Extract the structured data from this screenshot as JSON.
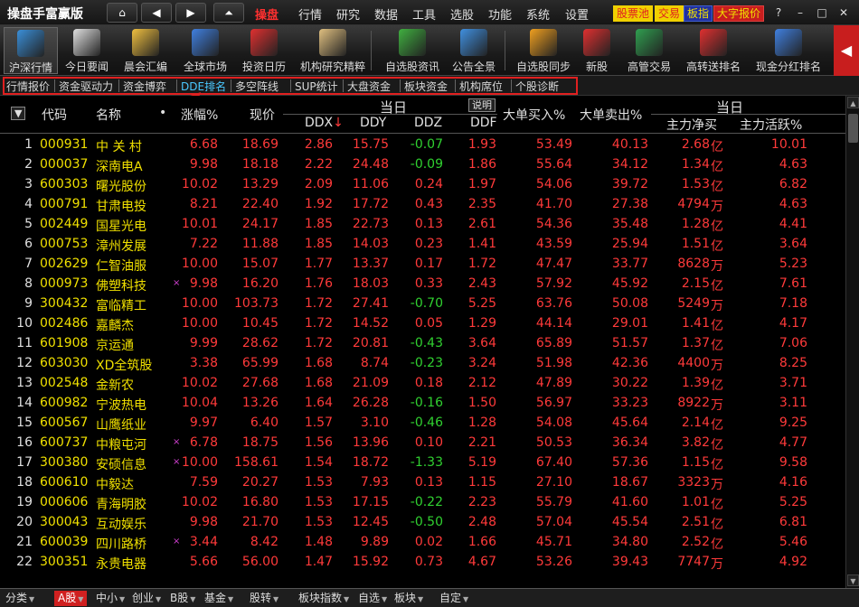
{
  "app": {
    "title": "操盘手富赢版"
  },
  "nav": {
    "home": "⌂",
    "back": "◀",
    "forward": "▶",
    "top": "⏶"
  },
  "menu": [
    "操盘",
    "行情",
    "研究",
    "数据",
    "工具",
    "选股",
    "功能",
    "系统",
    "设置"
  ],
  "menu_active": 0,
  "tag_buttons": [
    "股票池",
    "交易",
    "板指",
    "大字报价"
  ],
  "window_controls": [
    "?",
    "–",
    "□",
    "✕"
  ],
  "toolbar": [
    {
      "label": "沪深行情",
      "icon": "market-chart-icon",
      "color": "#3a8fd8"
    },
    {
      "label": "今日要闻",
      "icon": "newspaper-icon",
      "color": "#e0e0e0"
    },
    {
      "label": "晨会汇编",
      "icon": "person-icon",
      "color": "#f0c040"
    },
    {
      "label": "全球市场",
      "icon": "globe-icon",
      "color": "#4080e0"
    },
    {
      "label": "投资日历",
      "icon": "calendar-icon",
      "color": "#e03030"
    },
    {
      "label": "机构研究精粹",
      "icon": "clipboard-icon",
      "color": "#e0c080"
    },
    {
      "label": "自选股资讯",
      "icon": "money-hand-icon",
      "color": "#40b040"
    },
    {
      "label": "公告全景",
      "icon": "megaphone-icon",
      "color": "#4090e0"
    },
    {
      "label": "自选股同步",
      "icon": "sync-icon",
      "color": "#f0a020"
    },
    {
      "label": "新股",
      "icon": "new-stock-icon",
      "color": "#e03030"
    },
    {
      "label": "高管交易",
      "icon": "monitor-new-icon",
      "color": "#30a050"
    },
    {
      "label": "高转送排名",
      "icon": "calendar-rank-icon",
      "color": "#e03030"
    },
    {
      "label": "现金分红排名",
      "icon": "bar-chart-icon",
      "color": "#4080e0"
    }
  ],
  "subtabs": [
    "行情报价",
    "资金驱动力",
    "资金博弈",
    "DDE排名",
    "多空阵线",
    "SUP统计",
    "大盘资金",
    "板块资金",
    "机构席位",
    "个股诊断"
  ],
  "subtab_active": 3,
  "header": {
    "menu_glyph": "▼",
    "code": "代码",
    "name": "名称",
    "dot": "•",
    "change": "涨幅%",
    "price": "现价",
    "group1": "当日",
    "ddx": "DDX",
    "ddx_sort": "↓",
    "ddy": "DDY",
    "ddz": "DDZ",
    "ddf": "DDF",
    "explain": "说明",
    "big_buy": "大单买入%",
    "big_sell": "大单卖出%",
    "group2": "当日",
    "net_main": "主力净买",
    "main_active": "主力活跃%"
  },
  "rows": [
    {
      "idx": "1",
      "code": "000931",
      "name": "中 关 村",
      "mark": "",
      "chg": "6.68",
      "price": "18.69",
      "ddx": "2.86",
      "ddy": "15.75",
      "ddz": "-0.07",
      "ddf": "1.93",
      "buy": "53.49",
      "sell": "40.13",
      "net": "2.68",
      "unit": "亿",
      "act": "10.01"
    },
    {
      "idx": "2",
      "code": "000037",
      "name": "深南电A",
      "mark": "",
      "chg": "9.98",
      "price": "18.18",
      "ddx": "2.22",
      "ddy": "24.48",
      "ddz": "-0.09",
      "ddf": "1.86",
      "buy": "55.64",
      "sell": "34.12",
      "net": "1.34",
      "unit": "亿",
      "act": "4.63"
    },
    {
      "idx": "3",
      "code": "600303",
      "name": "曙光股份",
      "mark": "",
      "chg": "10.02",
      "price": "13.29",
      "ddx": "2.09",
      "ddy": "11.06",
      "ddz": "0.24",
      "ddf": "1.97",
      "buy": "54.06",
      "sell": "39.72",
      "net": "1.53",
      "unit": "亿",
      "act": "6.82"
    },
    {
      "idx": "4",
      "code": "000791",
      "name": "甘肃电投",
      "mark": "",
      "chg": "8.21",
      "price": "22.40",
      "ddx": "1.92",
      "ddy": "17.72",
      "ddz": "0.43",
      "ddf": "2.35",
      "buy": "41.70",
      "sell": "27.38",
      "net": "4794",
      "unit": "万",
      "act": "4.63"
    },
    {
      "idx": "5",
      "code": "002449",
      "name": "国星光电",
      "mark": "",
      "chg": "10.01",
      "price": "24.17",
      "ddx": "1.85",
      "ddy": "22.73",
      "ddz": "0.13",
      "ddf": "2.61",
      "buy": "54.36",
      "sell": "35.48",
      "net": "1.28",
      "unit": "亿",
      "act": "4.41"
    },
    {
      "idx": "6",
      "code": "000753",
      "name": "漳州发展",
      "mark": "",
      "chg": "7.22",
      "price": "11.88",
      "ddx": "1.85",
      "ddy": "14.03",
      "ddz": "0.23",
      "ddf": "1.41",
      "buy": "43.59",
      "sell": "25.94",
      "net": "1.51",
      "unit": "亿",
      "act": "3.64"
    },
    {
      "idx": "7",
      "code": "002629",
      "name": "仁智油服",
      "mark": "",
      "chg": "10.00",
      "price": "15.07",
      "ddx": "1.77",
      "ddy": "13.37",
      "ddz": "0.17",
      "ddf": "1.72",
      "buy": "47.47",
      "sell": "33.77",
      "net": "8628",
      "unit": "万",
      "act": "5.23"
    },
    {
      "idx": "8",
      "code": "000973",
      "name": "佛塑科技",
      "mark": "×",
      "chg": "9.98",
      "price": "16.20",
      "ddx": "1.76",
      "ddy": "18.03",
      "ddz": "0.33",
      "ddf": "2.43",
      "buy": "57.92",
      "sell": "45.92",
      "net": "2.15",
      "unit": "亿",
      "act": "7.61"
    },
    {
      "idx": "9",
      "code": "300432",
      "name": "富临精工",
      "mark": "",
      "chg": "10.00",
      "price": "103.73",
      "ddx": "1.72",
      "ddy": "27.41",
      "ddz": "-0.70",
      "ddf": "5.25",
      "buy": "63.76",
      "sell": "50.08",
      "net": "5249",
      "unit": "万",
      "act": "7.18"
    },
    {
      "idx": "10",
      "code": "002486",
      "name": "嘉麟杰",
      "mark": "",
      "chg": "10.00",
      "price": "10.45",
      "ddx": "1.72",
      "ddy": "14.52",
      "ddz": "0.05",
      "ddf": "1.29",
      "buy": "44.14",
      "sell": "29.01",
      "net": "1.41",
      "unit": "亿",
      "act": "4.17"
    },
    {
      "idx": "11",
      "code": "601908",
      "name": "京运通",
      "mark": "",
      "chg": "9.99",
      "price": "28.62",
      "ddx": "1.72",
      "ddy": "20.81",
      "ddz": "-0.43",
      "ddf": "3.64",
      "buy": "65.89",
      "sell": "51.57",
      "net": "1.37",
      "unit": "亿",
      "act": "7.06"
    },
    {
      "idx": "12",
      "code": "603030",
      "name": "XD全筑股",
      "mark": "",
      "chg": "3.38",
      "price": "65.99",
      "ddx": "1.68",
      "ddy": "8.74",
      "ddz": "-0.23",
      "ddf": "3.24",
      "buy": "51.98",
      "sell": "42.36",
      "net": "4400",
      "unit": "万",
      "act": "8.25"
    },
    {
      "idx": "13",
      "code": "002548",
      "name": "金新农",
      "mark": "",
      "chg": "10.02",
      "price": "27.68",
      "ddx": "1.68",
      "ddy": "21.09",
      "ddz": "0.18",
      "ddf": "2.12",
      "buy": "47.89",
      "sell": "30.22",
      "net": "1.39",
      "unit": "亿",
      "act": "3.71"
    },
    {
      "idx": "14",
      "code": "600982",
      "name": "宁波热电",
      "mark": "",
      "chg": "10.04",
      "price": "13.26",
      "ddx": "1.64",
      "ddy": "26.28",
      "ddz": "-0.16",
      "ddf": "1.50",
      "buy": "56.97",
      "sell": "33.23",
      "net": "8922",
      "unit": "万",
      "act": "3.11"
    },
    {
      "idx": "15",
      "code": "600567",
      "name": "山鹰纸业",
      "mark": "",
      "chg": "9.97",
      "price": "6.40",
      "ddx": "1.57",
      "ddy": "3.10",
      "ddz": "-0.46",
      "ddf": "1.28",
      "buy": "54.08",
      "sell": "45.64",
      "net": "2.14",
      "unit": "亿",
      "act": "9.25"
    },
    {
      "idx": "16",
      "code": "600737",
      "name": "中粮屯河",
      "mark": "×",
      "chg": "6.78",
      "price": "18.75",
      "ddx": "1.56",
      "ddy": "13.96",
      "ddz": "0.10",
      "ddf": "2.21",
      "buy": "50.53",
      "sell": "36.34",
      "net": "3.82",
      "unit": "亿",
      "act": "4.77"
    },
    {
      "idx": "17",
      "code": "300380",
      "name": "安硕信息",
      "mark": "×",
      "chg": "10.00",
      "price": "158.61",
      "ddx": "1.54",
      "ddy": "18.72",
      "ddz": "-1.33",
      "ddf": "5.19",
      "buy": "67.40",
      "sell": "57.36",
      "net": "1.15",
      "unit": "亿",
      "act": "9.58"
    },
    {
      "idx": "18",
      "code": "600610",
      "name": "中毅达",
      "mark": "",
      "chg": "7.59",
      "price": "20.27",
      "ddx": "1.53",
      "ddy": "7.93",
      "ddz": "0.13",
      "ddf": "1.15",
      "buy": "27.10",
      "sell": "18.67",
      "net": "3323",
      "unit": "万",
      "act": "4.16"
    },
    {
      "idx": "19",
      "code": "000606",
      "name": "青海明胶",
      "mark": "",
      "chg": "10.02",
      "price": "16.80",
      "ddx": "1.53",
      "ddy": "17.15",
      "ddz": "-0.22",
      "ddf": "2.23",
      "buy": "55.79",
      "sell": "41.60",
      "net": "1.01",
      "unit": "亿",
      "act": "5.25"
    },
    {
      "idx": "20",
      "code": "300043",
      "name": "互动娱乐",
      "mark": "",
      "chg": "9.98",
      "price": "21.70",
      "ddx": "1.53",
      "ddy": "12.45",
      "ddz": "-0.50",
      "ddf": "2.48",
      "buy": "57.04",
      "sell": "45.54",
      "net": "2.51",
      "unit": "亿",
      "act": "6.81"
    },
    {
      "idx": "21",
      "code": "600039",
      "name": "四川路桥",
      "mark": "×",
      "chg": "3.44",
      "price": "8.42",
      "ddx": "1.48",
      "ddy": "9.89",
      "ddz": "0.02",
      "ddf": "1.66",
      "buy": "45.71",
      "sell": "34.80",
      "net": "2.52",
      "unit": "亿",
      "act": "5.46"
    },
    {
      "idx": "22",
      "code": "300351",
      "name": "永贵电器",
      "mark": "",
      "chg": "5.66",
      "price": "56.00",
      "ddx": "1.47",
      "ddy": "15.92",
      "ddz": "0.73",
      "ddf": "4.67",
      "buy": "53.26",
      "sell": "39.43",
      "net": "7747",
      "unit": "万",
      "act": "4.92"
    }
  ],
  "bottom_tabs": [
    "分类",
    "A股",
    "中小",
    "创业",
    "B股",
    "基金",
    "股转",
    "板块指数",
    "自选",
    "板块",
    "自定"
  ],
  "bottom_active": 1,
  "colors": {
    "up": "#ff3a3a",
    "down": "#30d030",
    "code": "#f0e000",
    "accent": "#e02020"
  }
}
